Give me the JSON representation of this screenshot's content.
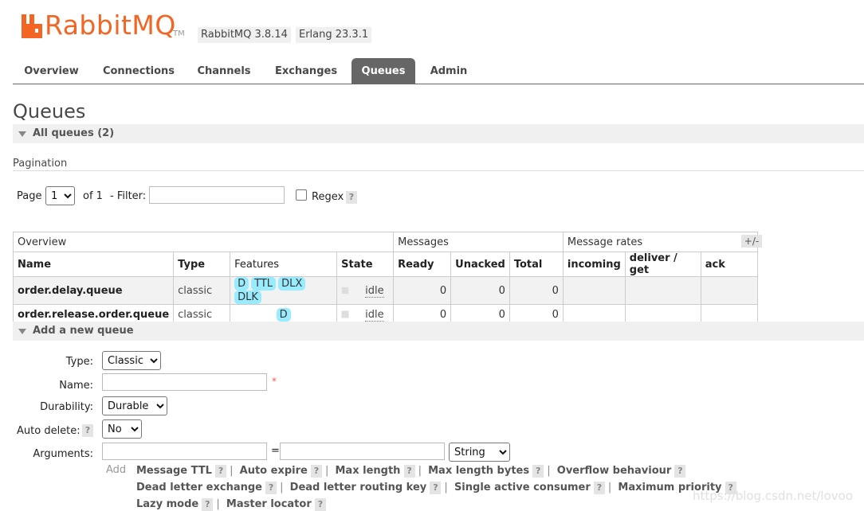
{
  "header": {
    "logo_text": "RabbitMQ",
    "tm": "TM",
    "version": "RabbitMQ 3.8.14",
    "erlang": "Erlang 23.3.1",
    "brand_color": "#f26522"
  },
  "tabs": [
    {
      "label": "Overview"
    },
    {
      "label": "Connections"
    },
    {
      "label": "Channels"
    },
    {
      "label": "Exchanges"
    },
    {
      "label": "Queues",
      "active": true
    },
    {
      "label": "Admin"
    }
  ],
  "page_title": "Queues",
  "all_queues": {
    "label": "All queues (2)"
  },
  "pagination": {
    "heading": "Pagination",
    "page_label": "Page",
    "page_value": "1",
    "of_label": "of 1",
    "filter_label": "- Filter:",
    "filter_value": "",
    "regex_label": "Regex",
    "help": "?"
  },
  "table": {
    "groups": {
      "overview": "Overview",
      "messages": "Messages",
      "rates": "Message rates"
    },
    "columns": [
      "Name",
      "Type",
      "Features",
      "State",
      "Ready",
      "Unacked",
      "Total",
      "incoming",
      "deliver / get",
      "ack"
    ],
    "plus_minus": "+/-",
    "rows": [
      {
        "name": "order.delay.queue",
        "type": "classic",
        "features": [
          "D",
          "TTL",
          "DLX",
          "DLK"
        ],
        "state": "idle",
        "ready": "0",
        "unacked": "0",
        "total": "0"
      },
      {
        "name": "order.release.order.queue",
        "type": "classic",
        "features": [
          "D"
        ],
        "state": "idle",
        "ready": "0",
        "unacked": "0",
        "total": "0"
      }
    ]
  },
  "add_queue": {
    "label": "Add a new queue",
    "type_label": "Type:",
    "type_value": "Classic",
    "name_label": "Name:",
    "name_value": "",
    "required_mark": "*",
    "durability_label": "Durability:",
    "durability_value": "Durable",
    "auto_delete_label": "Auto delete:",
    "auto_delete_value": "No",
    "arguments_label": "Arguments:",
    "arg_eq": "=",
    "arg_type_value": "String",
    "add_label": "Add",
    "arg_links": [
      [
        "Message TTL",
        "Auto expire",
        "Max length",
        "Max length bytes",
        "Overflow behaviour"
      ],
      [
        "Dead letter exchange",
        "Dead letter routing key",
        "Single active consumer",
        "Maximum priority"
      ],
      [
        "Lazy mode",
        "Master locator"
      ]
    ]
  },
  "watermark": "https://blog.csdn.net/lovoo"
}
